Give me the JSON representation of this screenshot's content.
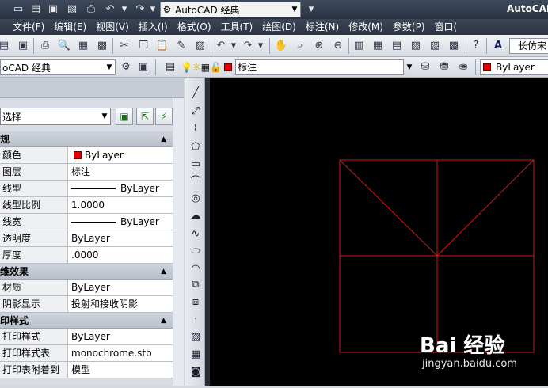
{
  "titlebar": {
    "workspace": "AutoCAD 经典",
    "app_title": "AutoCAD"
  },
  "menubar": {
    "items": [
      "文件(F)",
      "编辑(E)",
      "视图(V)",
      "插入(I)",
      "格式(O)",
      "工具(T)",
      "绘图(D)",
      "标注(N)",
      "修改(M)",
      "参数(P)",
      "窗口("
    ]
  },
  "toolbar1": {
    "font_style": "长仿宋"
  },
  "toolbar2": {
    "workspace": "oCAD 经典",
    "layer": "标注",
    "color": "ByLayer"
  },
  "palette": {
    "selection": "选择",
    "sections": [
      {
        "title": "规",
        "rows": [
          {
            "key": "颜色",
            "value": "ByLayer",
            "swatch": true
          },
          {
            "key": "图层",
            "value": "标注"
          },
          {
            "key": "线型",
            "value": "ByLayer",
            "line": true
          },
          {
            "key": "线型比例",
            "value": "1.0000"
          },
          {
            "key": "线宽",
            "value": "ByLayer",
            "line": true
          },
          {
            "key": "透明度",
            "value": "ByLayer"
          },
          {
            "key": "厚度",
            "value": ".0000"
          }
        ]
      },
      {
        "title": "维效果",
        "rows": [
          {
            "key": "材质",
            "value": "ByLayer"
          },
          {
            "key": "阴影显示",
            "value": "投射和接收阴影"
          }
        ]
      },
      {
        "title": "印样式",
        "rows": [
          {
            "key": "打印样式",
            "value": "ByLayer"
          },
          {
            "key": "打印样式表",
            "value": "monochrome.stb"
          },
          {
            "key": "打印表附着到",
            "value": "模型"
          }
        ]
      }
    ]
  },
  "colors": {
    "accent_red": "#e00000",
    "drawing_line": "#d01818",
    "canvas": "#000000"
  },
  "watermark": {
    "brand": "Bai 经验",
    "url": "jingyan.baidu.com"
  }
}
